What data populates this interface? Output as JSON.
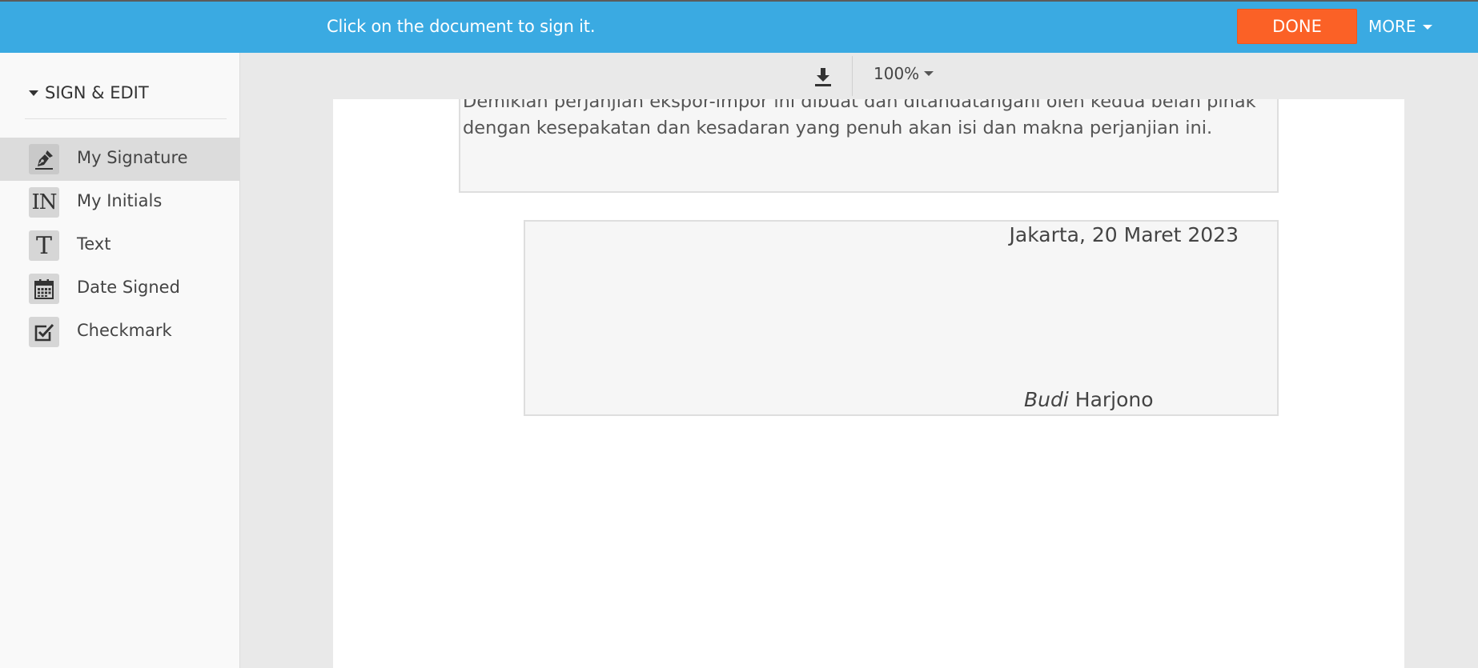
{
  "topbar": {
    "message": "Click on the document to sign it.",
    "done_label": "DONE",
    "more_label": "MORE"
  },
  "sidebar": {
    "section_title": "SIGN & EDIT",
    "items": [
      {
        "label": "My Signature",
        "icon": "pen-nib-icon",
        "active": true
      },
      {
        "label": "My Initials",
        "icon": "initials-icon",
        "icon_text": "IN"
      },
      {
        "label": "Text",
        "icon": "text-icon",
        "icon_text": "T"
      },
      {
        "label": "Date Signed",
        "icon": "calendar-icon"
      },
      {
        "label": "Checkmark",
        "icon": "checkbox-icon"
      }
    ]
  },
  "toolbar": {
    "zoom": "100%"
  },
  "document": {
    "paragraph": "Demikian perjanjian ekspor-impor ini dibuat dan ditandatangani oleh kedua belah pihak dengan kesepakatan dan kesadaran yang penuh akan isi dan makna perjanjian ini.",
    "place_date": "Jakarta, 20 Maret 2023",
    "signer_first": "Budi",
    "signer_last": "Harjono"
  },
  "colors": {
    "topbar": "#3aaae2",
    "done_button": "#fb6126",
    "sidebar_bg": "#f9f9f9",
    "active_item_bg": "#dcdcdc"
  }
}
